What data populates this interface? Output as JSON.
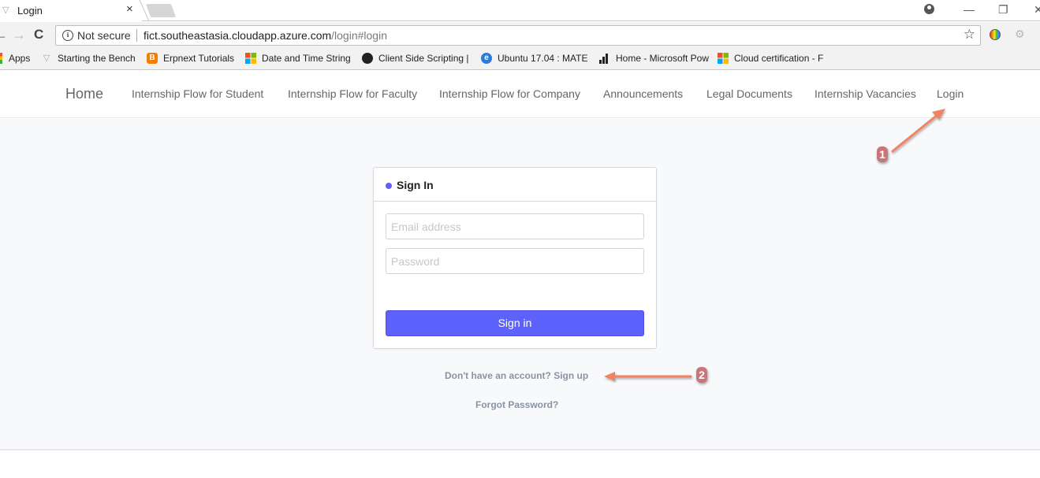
{
  "browser": {
    "tab": {
      "title": "Login",
      "close": "×"
    },
    "window_controls": {
      "minimize": "—",
      "restore": "❐",
      "close": "✕"
    },
    "toolbar": {
      "back": "←",
      "forward": "→",
      "reload": "C",
      "security_label": "Not secure",
      "url_host": "fict.southeastasia.cloudapp.azure.com",
      "url_path": "/login#login",
      "star": "☆",
      "ext_gear": "⚙"
    },
    "bookmarks": [
      {
        "icon": "apps-icon",
        "label": "Apps"
      },
      {
        "icon": "bench-icon",
        "label": "Starting the Bench"
      },
      {
        "icon": "blogger-icon",
        "label": "Erpnext Tutorials"
      },
      {
        "icon": "microsoft-icon",
        "label": "Date and Time String"
      },
      {
        "icon": "github-icon",
        "label": "Client Side Scripting |"
      },
      {
        "icon": "ie-icon",
        "label": "Ubuntu 17.04 : MATE"
      },
      {
        "icon": "powerbi-icon",
        "label": "Home - Microsoft Pow"
      },
      {
        "icon": "microsoft-icon",
        "label": "Cloud certification - F"
      }
    ]
  },
  "site_nav": {
    "home": "Home",
    "links": [
      "Internship Flow for Student",
      "Internship Flow for Faculty",
      "Internship Flow for Company",
      "Announcements",
      "Legal Documents",
      "Internship Vacancies",
      "Login"
    ]
  },
  "signin_card": {
    "title": "Sign In",
    "email_placeholder": "Email address",
    "email_value": "",
    "password_placeholder": "Password",
    "password_value": "",
    "submit_label": "Sign in",
    "accent_color": "#5e62fd"
  },
  "links": {
    "signup": "Don't have an account? Sign up",
    "forgot": "Forgot Password?"
  },
  "annotations": [
    {
      "number": "1",
      "points_to": "Login"
    },
    {
      "number": "2",
      "points_to": "Sign up"
    }
  ]
}
